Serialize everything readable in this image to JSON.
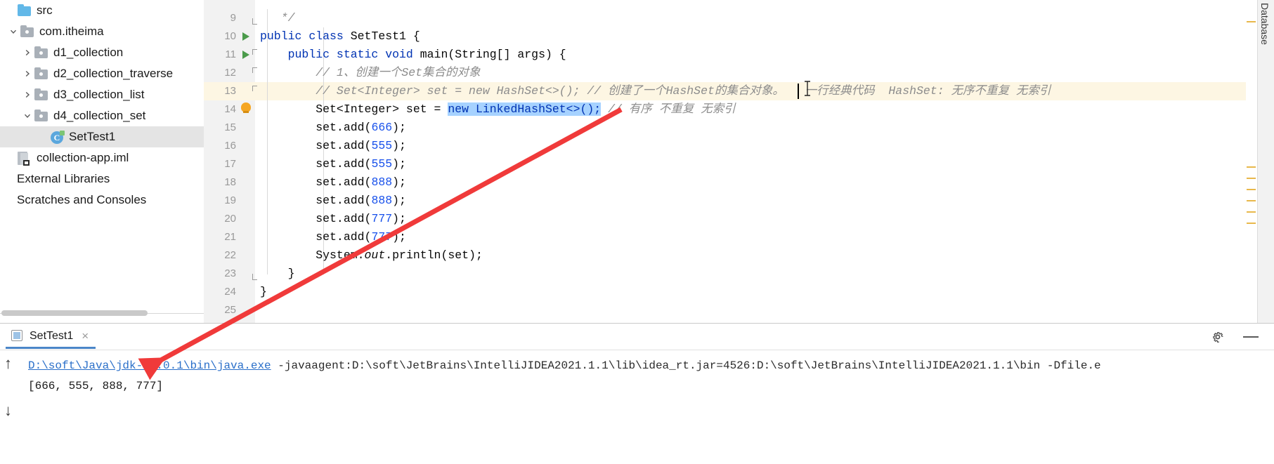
{
  "project_tree": {
    "items": [
      {
        "label": "src",
        "indent": 0,
        "chevron": "none",
        "icon": "folder-blue-icon",
        "selected": false
      },
      {
        "label": "com.itheima",
        "indent": 1,
        "chevron": "down",
        "icon": "folder-icon",
        "selected": false
      },
      {
        "label": "d1_collection",
        "indent": 2,
        "chevron": "right",
        "icon": "folder-icon",
        "selected": false
      },
      {
        "label": "d2_collection_traverse",
        "indent": 2,
        "chevron": "right",
        "icon": "folder-icon",
        "selected": false
      },
      {
        "label": "d3_collection_list",
        "indent": 2,
        "chevron": "right",
        "icon": "folder-icon",
        "selected": false
      },
      {
        "label": "d4_collection_set",
        "indent": 2,
        "chevron": "down",
        "icon": "folder-icon",
        "selected": false
      },
      {
        "label": "SetTest1",
        "indent": 3,
        "chevron": "none",
        "icon": "java-class-icon",
        "selected": true
      },
      {
        "label": "collection-app.iml",
        "indent": 0,
        "chevron": "none",
        "icon": "iml-module-icon",
        "selected": false
      },
      {
        "label": "External Libraries",
        "indent": 0,
        "chevron": "none",
        "icon": "none",
        "selected": false
      },
      {
        "label": "Scratches and Consoles",
        "indent": 0,
        "chevron": "none",
        "icon": "none",
        "selected": false
      }
    ]
  },
  "editor": {
    "lines": [
      {
        "number": "9",
        "marker": "none",
        "fold": "fold-end",
        "segments": [
          {
            "t": "   */",
            "c": "cmt"
          }
        ]
      },
      {
        "number": "10",
        "marker": "run",
        "fold": "none",
        "segments": [
          {
            "t": "public ",
            "c": "kw"
          },
          {
            "t": "class ",
            "c": "kw"
          },
          {
            "t": "SetTest1 {",
            "c": "plaintk"
          }
        ]
      },
      {
        "number": "11",
        "marker": "run",
        "fold": "fold-box",
        "segments": [
          {
            "t": "    ",
            "c": "plaintk"
          },
          {
            "t": "public static void ",
            "c": "kw"
          },
          {
            "t": "main(String[] args) {",
            "c": "plaintk"
          }
        ]
      },
      {
        "number": "12",
        "marker": "none",
        "fold": "fold-box",
        "segments": [
          {
            "t": "        // 1、创建一个Set集合的对象",
            "c": "cmt"
          }
        ]
      },
      {
        "number": "13",
        "marker": "none",
        "fold": "fold-box",
        "segments": [
          {
            "t": "        // Set<Integer> set = new HashSet<>(); // 创建了一个HashSet的集合对象。   一行经典代码  HashSet: 无序不重复 无索引",
            "c": "cmt"
          }
        ]
      },
      {
        "number": "14",
        "marker": "bulb",
        "fold": "none",
        "segments": [
          {
            "t": "        Set<Integer> set = ",
            "c": "plaintk"
          },
          {
            "t": "new LinkedHashSet<>();",
            "c": "sel"
          },
          {
            "t": " ",
            "c": "plaintk"
          },
          {
            "t": "// 有序 不重复 无索引",
            "c": "cmt"
          }
        ]
      },
      {
        "number": "15",
        "marker": "none",
        "fold": "none",
        "segments": [
          {
            "t": "        set.add(",
            "c": "plaintk"
          },
          {
            "t": "666",
            "c": "num"
          },
          {
            "t": ");",
            "c": "plaintk"
          }
        ]
      },
      {
        "number": "16",
        "marker": "none",
        "fold": "none",
        "segments": [
          {
            "t": "        set.add(",
            "c": "plaintk"
          },
          {
            "t": "555",
            "c": "num"
          },
          {
            "t": ");",
            "c": "plaintk"
          }
        ]
      },
      {
        "number": "17",
        "marker": "none",
        "fold": "none",
        "segments": [
          {
            "t": "        set.add(",
            "c": "plaintk"
          },
          {
            "t": "555",
            "c": "num"
          },
          {
            "t": ");",
            "c": "plaintk"
          }
        ]
      },
      {
        "number": "18",
        "marker": "none",
        "fold": "none",
        "segments": [
          {
            "t": "        set.add(",
            "c": "plaintk"
          },
          {
            "t": "888",
            "c": "num"
          },
          {
            "t": ");",
            "c": "plaintk"
          }
        ]
      },
      {
        "number": "19",
        "marker": "none",
        "fold": "none",
        "segments": [
          {
            "t": "        set.add(",
            "c": "plaintk"
          },
          {
            "t": "888",
            "c": "num"
          },
          {
            "t": ");",
            "c": "plaintk"
          }
        ]
      },
      {
        "number": "20",
        "marker": "none",
        "fold": "none",
        "segments": [
          {
            "t": "        set.add(",
            "c": "plaintk"
          },
          {
            "t": "777",
            "c": "num"
          },
          {
            "t": ");",
            "c": "plaintk"
          }
        ]
      },
      {
        "number": "21",
        "marker": "none",
        "fold": "none",
        "segments": [
          {
            "t": "        set.add(",
            "c": "plaintk"
          },
          {
            "t": "777",
            "c": "num"
          },
          {
            "t": ");",
            "c": "plaintk"
          }
        ]
      },
      {
        "number": "22",
        "marker": "none",
        "fold": "none",
        "segments": [
          {
            "t": "        System.",
            "c": "plaintk"
          },
          {
            "t": "out",
            "c": "fielditalic"
          },
          {
            "t": ".println(set);",
            "c": "plaintk"
          }
        ]
      },
      {
        "number": "23",
        "marker": "none",
        "fold": "fold-end",
        "segments": [
          {
            "t": "    }",
            "c": "plaintk"
          }
        ]
      },
      {
        "number": "24",
        "marker": "none",
        "fold": "none",
        "segments": [
          {
            "t": "}",
            "c": "plaintk"
          }
        ]
      },
      {
        "number": "25",
        "marker": "none",
        "fold": "none",
        "segments": [
          {
            "t": "",
            "c": "plaintk"
          }
        ]
      }
    ],
    "selection_text": "new LinkedHashSet<>();",
    "highlighted_line": "14"
  },
  "right_strip": {
    "database_tab_label": "Database"
  },
  "console": {
    "tab_label": "SetTest1",
    "close_label": "×",
    "command_link": "D:\\soft\\Java\\jdk-17.0.1\\bin\\java.exe",
    "command_rest": " -javaagent:D:\\soft\\JetBrains\\IntelliJIDEA2021.1.1\\lib\\idea_rt.jar=4526:D:\\soft\\JetBrains\\IntelliJIDEA2021.1.1\\bin -Dfile.e",
    "output": "[666, 555, 888, 777]",
    "up_arrow": "↑",
    "down_arrow": "↓"
  },
  "colors": {
    "selection_blue": "#a6d2ff",
    "line_highlight": "#fdf6e3",
    "keyword": "#0033b3",
    "number": "#1750eb",
    "comment": "#8c8c8c",
    "link": "#2a6fc9",
    "annotation_red": "#f03a3a",
    "tab_underline": "#4a86c8",
    "marker_yellow": "#e8b84b"
  }
}
